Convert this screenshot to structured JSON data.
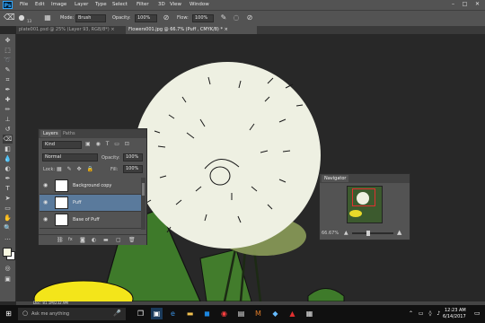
{
  "app": {
    "logo": "Ps"
  },
  "menu": [
    "File",
    "Edit",
    "Image",
    "Layer",
    "Type",
    "Select",
    "Filter",
    "3D",
    "View",
    "Window"
  ],
  "window_controls": [
    "–",
    "□",
    "✕"
  ],
  "options": {
    "mode_label": "Mode:",
    "mode_value": "Brush",
    "opacity_label": "Opacity:",
    "opacity_value": "100%",
    "flow_label": "Flow:",
    "flow_value": "100%",
    "brush_size": "13"
  },
  "tabs": [
    {
      "label": "plate001.psd @ 25% (Layer 93, RGB/8*) ×",
      "active": false
    },
    {
      "label": "Flowers001.jpg @ 66.7% (Puff , CMYK/8) * ×",
      "active": true
    }
  ],
  "layers_panel": {
    "tabs": [
      "Layers",
      "Paths"
    ],
    "kind_value": "Kind",
    "blend_value": "Normal",
    "opacity_label": "Opacity:",
    "opacity_value": "100%",
    "lock_label": "Lock:",
    "fill_label": "Fill:",
    "fill_value": "100%",
    "layers": [
      {
        "name": "Background copy",
        "selected": false
      },
      {
        "name": "Puff",
        "selected": true
      },
      {
        "name": "Base of Puff",
        "selected": false
      }
    ],
    "footer_icons": [
      "link-icon",
      "fx-icon",
      "mask-icon",
      "adjustment-icon",
      "folder-icon",
      "new-layer-icon",
      "trash-icon"
    ]
  },
  "navigator_panel": {
    "title": "Navigator",
    "zoom_value": "66.67%"
  },
  "status": {
    "doc_info": "Doc: 81.1M/232.9M"
  },
  "taskbar": {
    "search_placeholder": "Ask me anything",
    "time": "12:23 AM",
    "date": "6/14/2017"
  },
  "colors": {
    "accent": "#31a8ff",
    "selected_layer": "#5a7a9c",
    "puff": "#eef0e2",
    "leaf": "#3e7a2a"
  }
}
